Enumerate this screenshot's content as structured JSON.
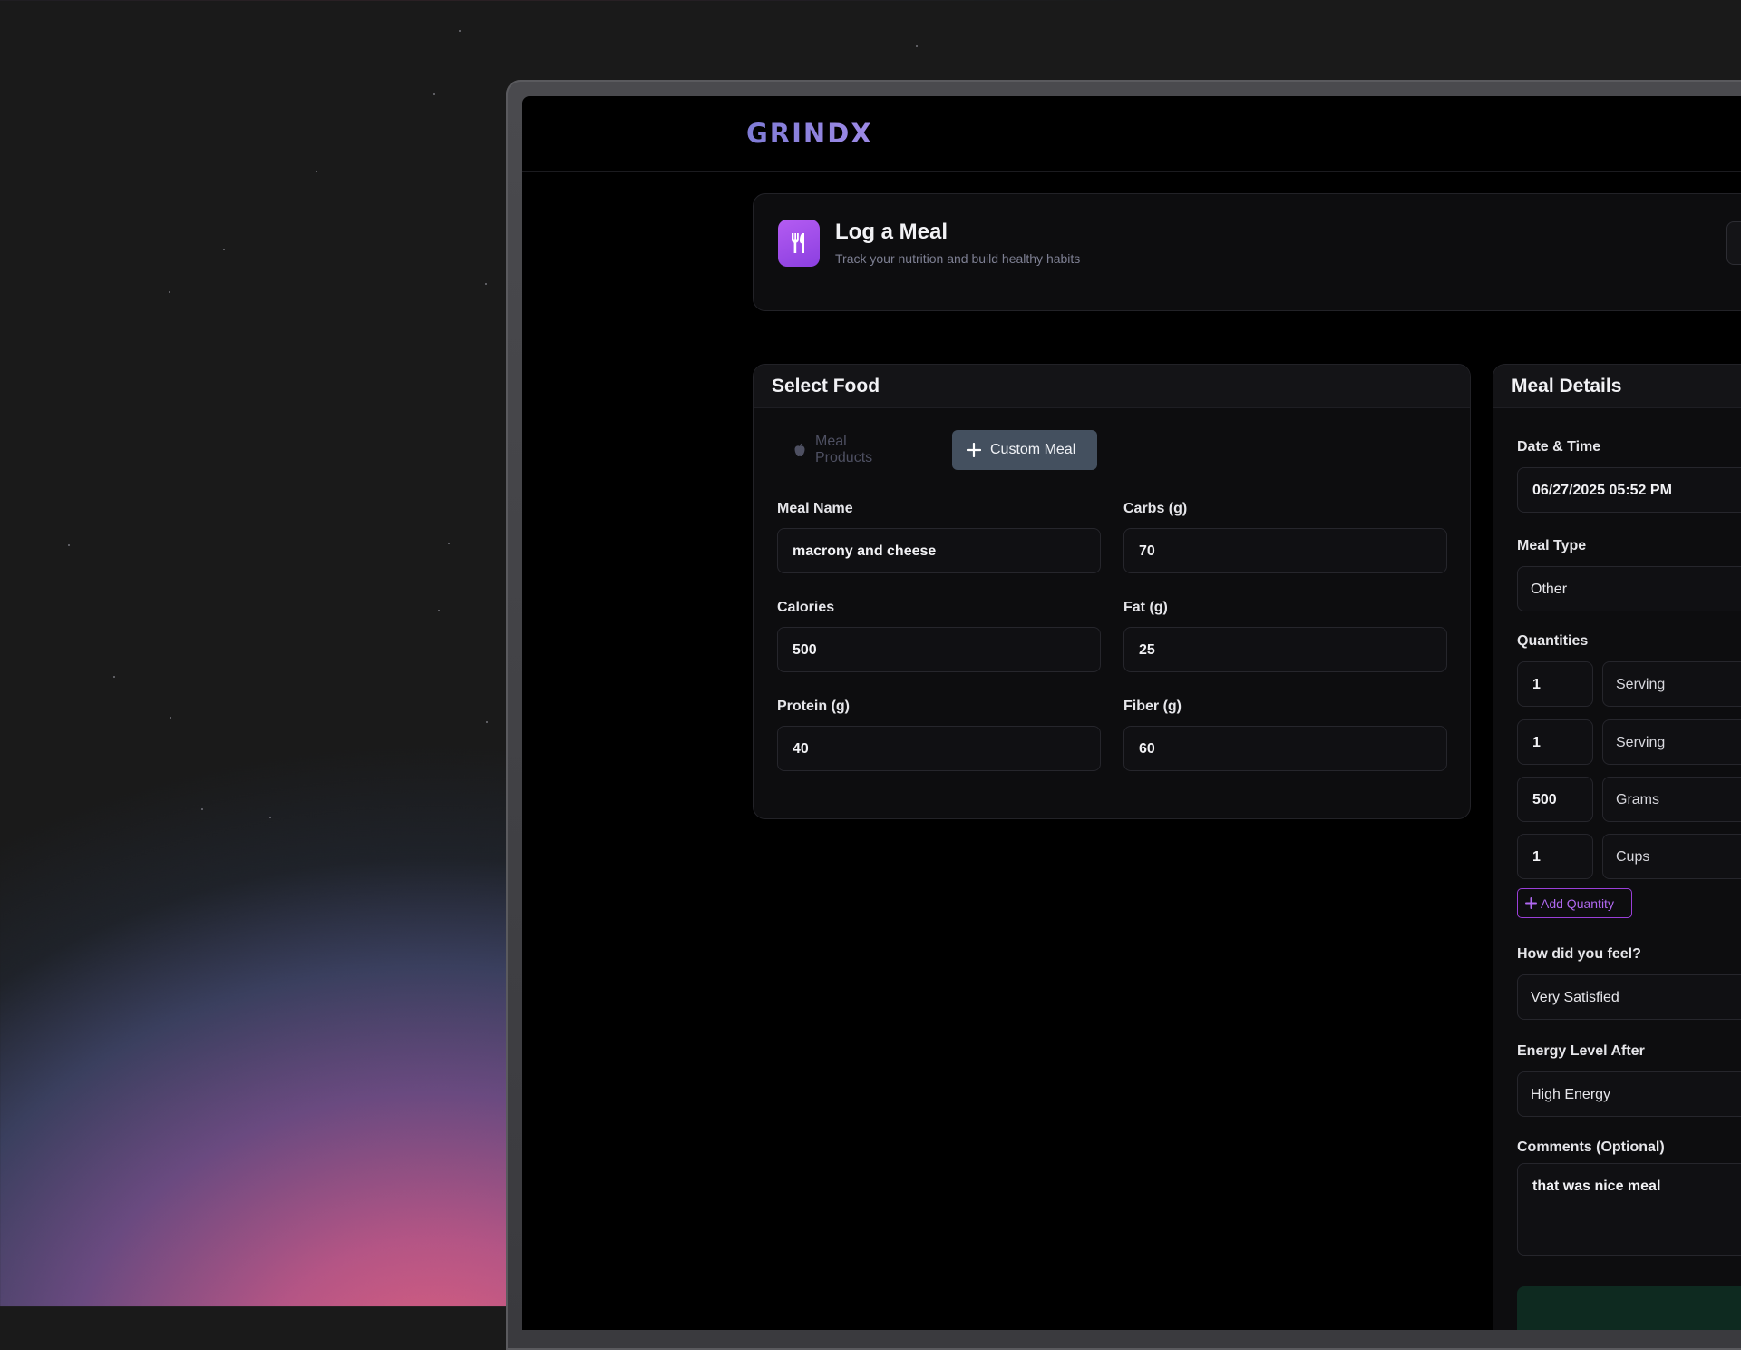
{
  "app": {
    "logo": "GRINDX"
  },
  "header": {
    "title": "Log a Meal",
    "subtitle": "Track your nutrition and build healthy habits",
    "close_label": "×",
    "icon": "utensils-icon"
  },
  "select_food": {
    "title": "Select Food",
    "tabs": [
      {
        "label": "Meal Products",
        "icon": "apple-icon",
        "active": false
      },
      {
        "label": "Custom Meal",
        "icon": "plus-icon",
        "active": true
      }
    ],
    "fields": {
      "meal_name": {
        "label": "Meal Name",
        "value": "macrony and cheese"
      },
      "carbs": {
        "label": "Carbs (g)",
        "value": "70"
      },
      "calories": {
        "label": "Calories",
        "value": "500"
      },
      "fat": {
        "label": "Fat (g)",
        "value": "25"
      },
      "protein": {
        "label": "Protein (g)",
        "value": "40"
      },
      "fiber": {
        "label": "Fiber (g)",
        "value": "60"
      }
    }
  },
  "meal_details": {
    "title": "Meal Details",
    "date_time": {
      "label": "Date & Time",
      "value": "06/27/2025 05:52 PM"
    },
    "meal_type": {
      "label": "Meal Type",
      "value": "Other"
    },
    "quantities": {
      "label": "Quantities",
      "rows": [
        {
          "amount": "1",
          "unit": "Serving"
        },
        {
          "amount": "1",
          "unit": "Serving"
        },
        {
          "amount": "500",
          "unit": "Grams"
        },
        {
          "amount": "1",
          "unit": "Cups"
        }
      ],
      "add_label": "Add Quantity"
    },
    "feeling": {
      "label": "How did you feel?",
      "value": "Very Satisfied"
    },
    "energy": {
      "label": "Energy Level After",
      "value": "High Energy"
    },
    "comments": {
      "label": "Comments (Optional)",
      "value": "that was nice meal"
    }
  },
  "colors": {
    "accent": "#9b4ef0",
    "logo": "#8a82e0",
    "active_tab": "#44505f"
  }
}
